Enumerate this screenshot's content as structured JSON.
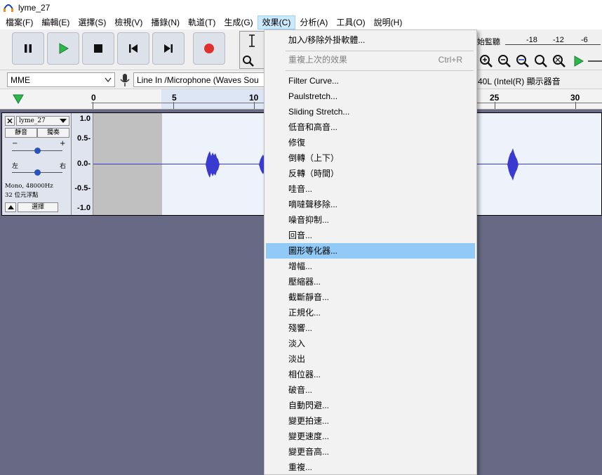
{
  "window": {
    "title": "lyme_27"
  },
  "menubar": [
    "檔案(F)",
    "編輯(E)",
    "選擇(S)",
    "檢視(V)",
    "播錄(N)",
    "軌道(T)",
    "生成(G)",
    "效果(C)",
    "分析(A)",
    "工具(O)",
    "說明(H)"
  ],
  "devices": {
    "host": "MME",
    "input": "Line In /Microphone (Waves Sou",
    "output_partial": "40L (Intel(R) 顯示器音"
  },
  "meter": {
    "label": "始監聽",
    "ticks": [
      "-18",
      "-12",
      "-6"
    ]
  },
  "ruler": {
    "ticks": [
      "0",
      "5",
      "10",
      "25",
      "30"
    ]
  },
  "track": {
    "name": "lyme_27",
    "mute": "靜音",
    "solo": "獨奏",
    "gain_minus": "−",
    "gain_plus": "+",
    "pan_left": "左",
    "pan_right": "右",
    "info_line1": "Mono, 48000Hz",
    "info_line2": "32 位元浮點",
    "select": "選擇",
    "scale": [
      "1.0",
      "0.5-",
      "0.0-",
      "-0.5-",
      "-1.0"
    ]
  },
  "effects_menu": {
    "items": [
      {
        "label": "加入/移除外掛軟體...",
        "disabled": false
      },
      {
        "label": "重複上次的效果",
        "shortcut": "Ctrl+R",
        "disabled": true
      },
      {
        "label": "Filter Curve..."
      },
      {
        "label": "Paulstretch..."
      },
      {
        "label": "Sliding Stretch..."
      },
      {
        "label": "低音和高音..."
      },
      {
        "label": "修復"
      },
      {
        "label": "倒轉（上下）"
      },
      {
        "label": "反轉（時間）"
      },
      {
        "label": "哇音..."
      },
      {
        "label": "嘀噠聲移除..."
      },
      {
        "label": "噪音抑制..."
      },
      {
        "label": "回音..."
      },
      {
        "label": "圖形等化器...",
        "highlighted": true
      },
      {
        "label": "增幅..."
      },
      {
        "label": "壓縮器..."
      },
      {
        "label": "截斷靜音..."
      },
      {
        "label": "正規化..."
      },
      {
        "label": "殘響..."
      },
      {
        "label": "淡入"
      },
      {
        "label": "淡出"
      },
      {
        "label": "相位器..."
      },
      {
        "label": "破音..."
      },
      {
        "label": "自動閃避..."
      },
      {
        "label": "變更拍速..."
      },
      {
        "label": "變更速度..."
      },
      {
        "label": "變更音高..."
      },
      {
        "label": "重複..."
      }
    ]
  }
}
